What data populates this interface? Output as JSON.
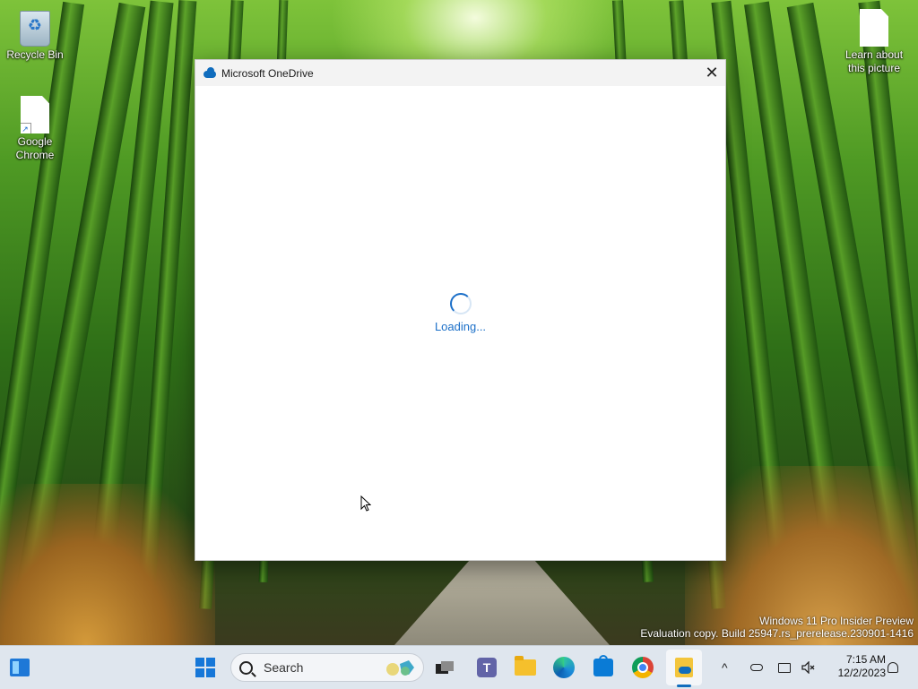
{
  "desktop": {
    "icons": {
      "recycle_bin": "Recycle Bin",
      "chrome": "Google Chrome",
      "learn_about": "Learn about this picture"
    },
    "watermark": {
      "line1": "Windows 11 Pro Insider Preview",
      "line2": "Evaluation copy. Build 25947.rs_prerelease.230901-1416"
    }
  },
  "window": {
    "title": "Microsoft OneDrive",
    "close_glyph": "✕",
    "loading_text": "Loading..."
  },
  "taskbar": {
    "search_placeholder": "Search",
    "teams_glyph": "T",
    "tray": {
      "chevron": "^"
    },
    "clock": {
      "time": "7:15 AM",
      "date": "12/2/2023"
    }
  },
  "colors": {
    "accent": "#1b6fc8",
    "taskbar": "#dfe6ee"
  }
}
